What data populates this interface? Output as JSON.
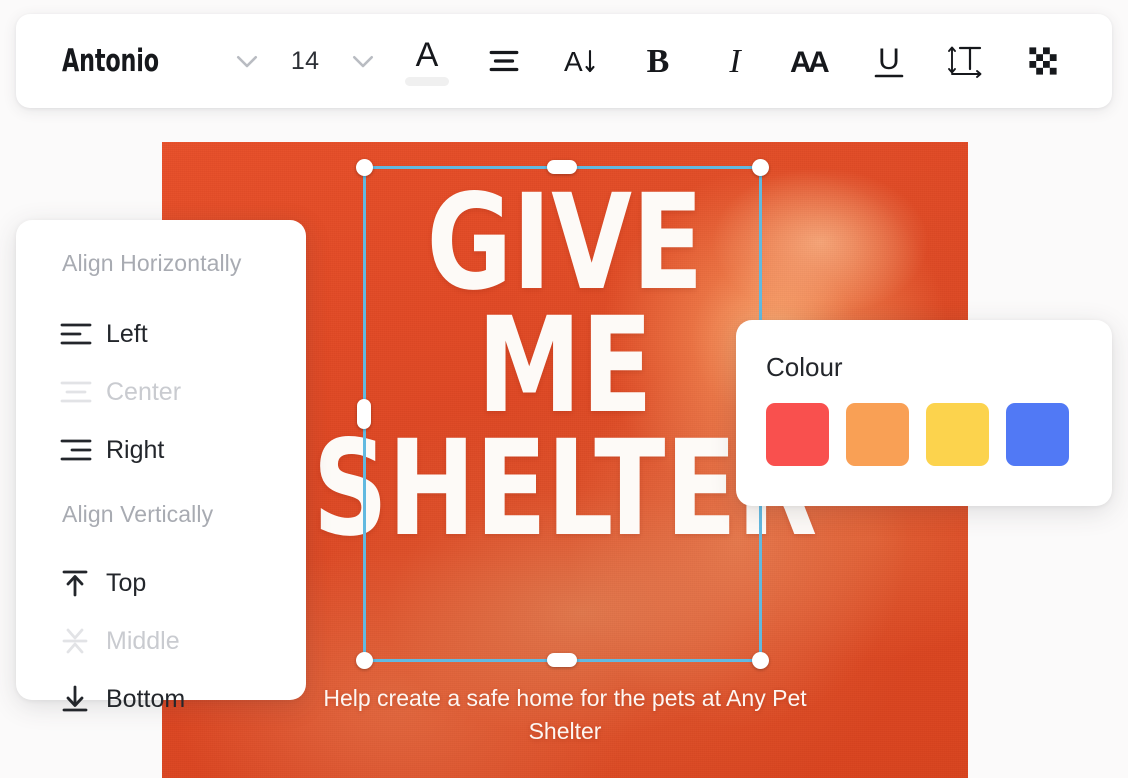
{
  "toolbar": {
    "font_family": "Antonio",
    "font_family_caret": "chevron-down-icon",
    "font_size": "14",
    "font_size_caret": "chevron-down-icon",
    "items": [
      {
        "name": "text-colour-button",
        "icon": "letter-a-colour-icon",
        "label": "A",
        "swatch": "#f0f0f0"
      },
      {
        "name": "text-align-button",
        "icon": "align-center-icon"
      },
      {
        "name": "text-case-button",
        "icon": "letter-a-arrow-down-icon"
      },
      {
        "name": "bold-button",
        "icon": "bold-icon",
        "label": "B"
      },
      {
        "name": "italic-button",
        "icon": "italic-icon",
        "label": "I"
      },
      {
        "name": "letter-spacing-button",
        "icon": "double-a-icon"
      },
      {
        "name": "underline-button",
        "icon": "underline-icon",
        "label": "U"
      },
      {
        "name": "text-spacing-button",
        "icon": "line-height-icon"
      },
      {
        "name": "transparency-button",
        "icon": "checkerboard-icon"
      }
    ]
  },
  "align_menu": {
    "horizontal_title": "Align Horizontally",
    "vertical_title": "Align Vertically",
    "horizontal_items": [
      {
        "label": "Left",
        "icon": "align-left-icon",
        "disabled": false
      },
      {
        "label": "Center",
        "icon": "align-center-icon",
        "disabled": true
      },
      {
        "label": "Right",
        "icon": "align-right-icon",
        "disabled": false
      }
    ],
    "vertical_items": [
      {
        "label": "Top",
        "icon": "align-top-icon",
        "disabled": false
      },
      {
        "label": "Middle",
        "icon": "align-middle-icon",
        "disabled": true
      },
      {
        "label": "Bottom",
        "icon": "align-bottom-icon",
        "disabled": false
      }
    ]
  },
  "colour_panel": {
    "title": "Colour",
    "swatches": [
      {
        "name": "colour-swatch-red",
        "hex": "#f9504e"
      },
      {
        "name": "colour-swatch-orange",
        "hex": "#f9a055"
      },
      {
        "name": "colour-swatch-yellow",
        "hex": "#fcd34d"
      },
      {
        "name": "colour-swatch-blue",
        "hex": "#5179f5"
      }
    ]
  },
  "poster": {
    "background_colour": "#e04a28",
    "headline_line_1": "GIVE",
    "headline_line_2": "ME",
    "headline_line_3": "SHELTER",
    "subtext": "Help create a safe home for the pets at Any Pet Shelter"
  },
  "selection": {
    "border_colour": "#62b9e0",
    "handle_colour": "#ffffff"
  }
}
